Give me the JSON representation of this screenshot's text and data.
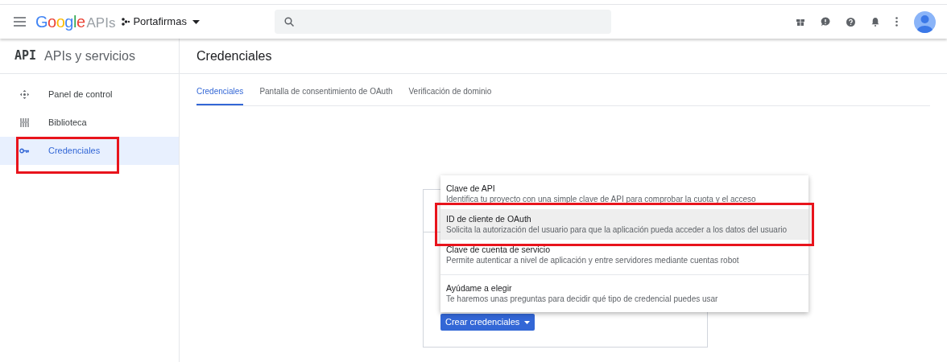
{
  "header": {
    "brand": "Google",
    "product": "APIs",
    "project": "Portafirmas"
  },
  "sidebar": {
    "logo": "API",
    "title": "APIs y servicios",
    "items": [
      {
        "label": "Panel de control",
        "selected": false,
        "annotated": false
      },
      {
        "label": "Biblioteca",
        "selected": false,
        "annotated": false
      },
      {
        "label": "Credenciales",
        "selected": true,
        "annotated": true
      }
    ]
  },
  "page_title": "Credenciales",
  "tabs": [
    {
      "label": "Credenciales",
      "selected": true
    },
    {
      "label": "Pantalla de consentimiento de OAuth",
      "selected": false
    },
    {
      "label": "Verificación de dominio",
      "selected": false
    }
  ],
  "create_button": "Crear credenciales",
  "menu": [
    {
      "title": "Clave de API",
      "description": "Identifica tu proyecto con una simple clave de API para comprobar la cuota y el acceso",
      "hovered": false,
      "annotated": false,
      "divider": false
    },
    {
      "title": "ID de cliente de OAuth",
      "description": "Solicita la autorización del usuario para que la aplicación pueda acceder a los datos del usuario",
      "hovered": true,
      "annotated": true,
      "divider": false
    },
    {
      "title": "Clave de cuenta de servicio",
      "description": "Permite autenticar a nivel de aplicación y entre servidores mediante cuentas robot",
      "hovered": false,
      "annotated": false,
      "divider": true
    },
    {
      "title": "Ayúdame a elegir",
      "description": "Te haremos unas preguntas para decidir qué tipo de credencial puedes usar",
      "hovered": false,
      "annotated": false,
      "divider": false
    }
  ]
}
